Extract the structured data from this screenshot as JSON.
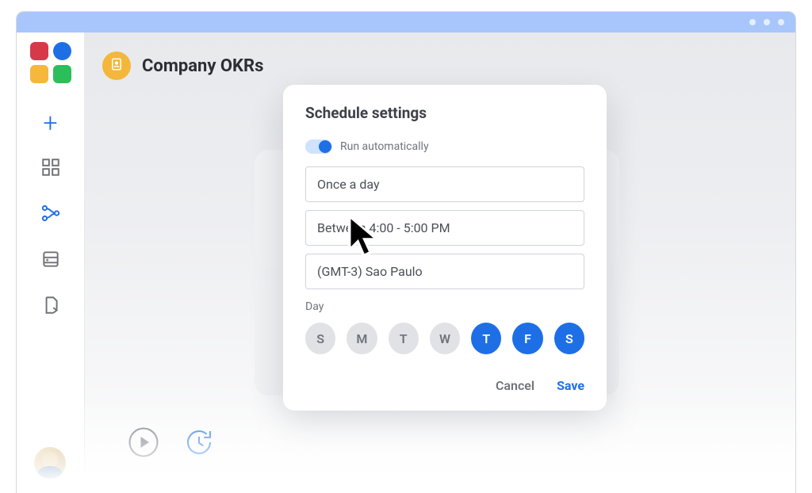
{
  "header": {
    "title": "Company OKRs"
  },
  "rail": {
    "items": [
      {
        "name": "add",
        "icon": "plus-icon"
      },
      {
        "name": "dashboard",
        "icon": "grid-icon"
      },
      {
        "name": "workflow",
        "icon": "workflow-icon",
        "active": true
      },
      {
        "name": "data",
        "icon": "database-icon"
      },
      {
        "name": "export",
        "icon": "page-export-icon"
      }
    ]
  },
  "actions": {
    "play_label": "Run",
    "schedule_label": "Schedule"
  },
  "modal": {
    "title": "Schedule settings",
    "toggle_label": "Run automatically",
    "toggle_on": true,
    "frequency": "Once a day",
    "time_window": "Between 4:00 - 5:00 PM",
    "timezone": "(GMT-3) Sao Paulo",
    "day_section_label": "Day",
    "days": [
      {
        "label": "S",
        "selected": false
      },
      {
        "label": "M",
        "selected": false
      },
      {
        "label": "T",
        "selected": false
      },
      {
        "label": "W",
        "selected": false
      },
      {
        "label": "T",
        "selected": true
      },
      {
        "label": "F",
        "selected": true
      },
      {
        "label": "S",
        "selected": true
      }
    ],
    "cancel_label": "Cancel",
    "save_label": "Save"
  },
  "colors": {
    "accent": "#1e6fe6",
    "titlebar": "#a8c6fb",
    "badge": "#f4b73c"
  }
}
